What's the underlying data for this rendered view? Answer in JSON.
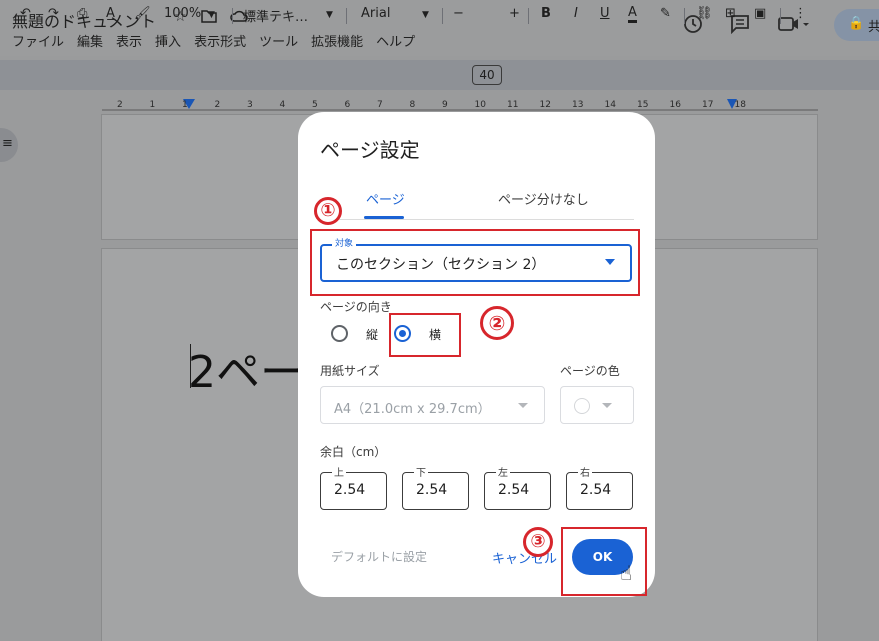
{
  "doc": {
    "title": "無題のドキュメント",
    "star_icon": "star-icon",
    "move_icon": "move-to-folder-icon",
    "cloud_icon": "cloud-status-icon"
  },
  "menu": [
    "ファイル",
    "編集",
    "表示",
    "挿入",
    "表示形式",
    "ツール",
    "拡張機能",
    "ヘルプ"
  ],
  "header_right": {
    "history_icon": "history-icon",
    "comment_icon": "comment-icon",
    "meet_icon": "meet-video-icon",
    "share_label": "共"
  },
  "toolbar": {
    "zoom": "100%",
    "style": "標準テキ…",
    "font": "Arial",
    "font_size": "40",
    "minus": "−",
    "plus": "+",
    "bold": "B",
    "italic": "I",
    "underline": "U",
    "text_color": "A"
  },
  "ruler": {
    "numbers": [
      "2",
      "1",
      "1",
      "2",
      "3",
      "4",
      "5",
      "6",
      "7",
      "8",
      "9",
      "10",
      "11",
      "12",
      "13",
      "14",
      "15",
      "16",
      "17",
      "18"
    ]
  },
  "document": {
    "body_text": "2ページ"
  },
  "dialog": {
    "title": "ページ設定",
    "tabs": [
      "ページ",
      "ページ分けなし"
    ],
    "scope": {
      "label": "対象",
      "value": "このセクション（セクション 2）"
    },
    "orientation": {
      "label": "ページの向き",
      "portrait": "縦",
      "landscape": "横",
      "selected": "横"
    },
    "paper_size": {
      "label": "用紙サイズ",
      "value": "A4（21.0cm x 29.7cm）"
    },
    "page_color": {
      "label": "ページの色"
    },
    "margins": {
      "label": "余白（cm）",
      "top": {
        "label": "上",
        "value": "2.54"
      },
      "bottom": {
        "label": "下",
        "value": "2.54"
      },
      "left": {
        "label": "左",
        "value": "2.54"
      },
      "right": {
        "label": "右",
        "value": "2.54"
      }
    },
    "buttons": {
      "default": "デフォルトに設定",
      "cancel": "キャンセル",
      "ok": "OK"
    }
  },
  "annotations": {
    "one": "①",
    "two": "②",
    "three": "③"
  },
  "colors": {
    "accent": "#1a62d4",
    "annotation_red": "#d7262c"
  }
}
